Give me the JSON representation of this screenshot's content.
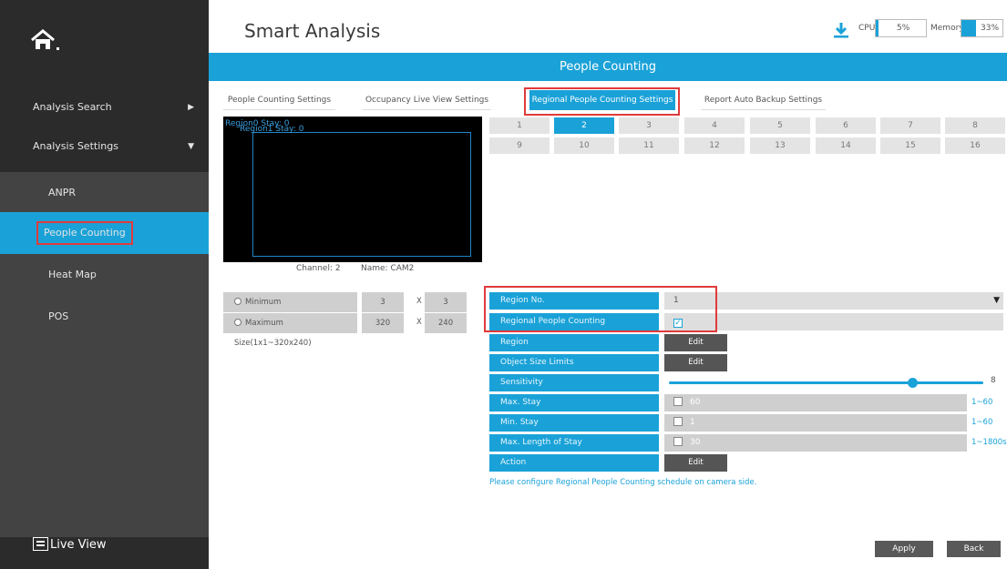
{
  "sidebar": {
    "analysis_search": "Analysis Search",
    "analysis_settings": "Analysis Settings",
    "items": [
      {
        "label": "ANPR"
      },
      {
        "label": "People Counting"
      },
      {
        "label": "Heat Map"
      },
      {
        "label": "POS"
      }
    ],
    "live_view": "Live View"
  },
  "header": {
    "title": "Smart Analysis",
    "cpu_label": "CPU",
    "cpu_value": "5%",
    "cpu_percent": 5,
    "memory_label": "Memory",
    "memory_value": "33%",
    "memory_percent": 33
  },
  "page_bar": "People Counting",
  "tabs": [
    {
      "label": "People Counting Settings"
    },
    {
      "label": "Occupancy Live View Settings"
    },
    {
      "label": "Regional People Counting Settings"
    },
    {
      "label": "Report Auto Backup Settings"
    }
  ],
  "preview": {
    "overlay_a": "Region0 Stay: 0",
    "overlay_b": "Region1 Stay: 0",
    "channel": "Channel: 2",
    "name": "Name: CAM2"
  },
  "regions": [
    "1",
    "2",
    "3",
    "4",
    "5",
    "6",
    "7",
    "8",
    "9",
    "10",
    "11",
    "12",
    "13",
    "14",
    "15",
    "16"
  ],
  "selected_region": "2",
  "size": {
    "min_label": "Minimum Size(1x1~320x240)",
    "min_w": "3",
    "min_h": "3",
    "max_label": "Maximum Size(1x1~320x240)",
    "max_w": "320",
    "max_h": "240",
    "x": "X"
  },
  "form": {
    "region_no_label": "Region No.",
    "region_no_value": "1",
    "regional_counting_label": "Regional People Counting",
    "region_label": "Region",
    "object_size_label": "Object Size Limits",
    "sensitivity_label": "Sensitivity",
    "sensitivity_value": "8",
    "max_stay_label": "Max. Stay",
    "max_stay_value": "60",
    "max_stay_range": "1~60",
    "min_stay_label": "Min. Stay",
    "min_stay_value": "1",
    "min_stay_range": "1~60",
    "max_length_label": "Max. Length of Stay",
    "max_length_value": "30",
    "max_length_range": "1~1800s",
    "action_label": "Action",
    "edit": "Edit"
  },
  "note": "Please configure Regional People Counting schedule on camera side.",
  "buttons": {
    "apply": "Apply",
    "back": "Back"
  },
  "colors": {
    "accent": "#1aa2d8",
    "highlight": "#e03b3b",
    "sidebar": "#2b2b2b"
  }
}
